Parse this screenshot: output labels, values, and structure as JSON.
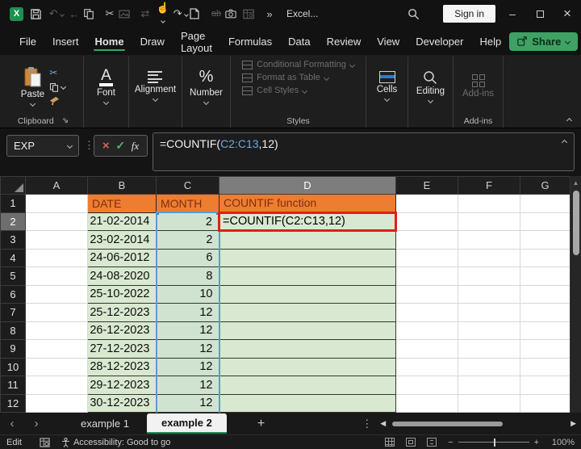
{
  "titlebar": {
    "app_title": "Excel...",
    "signin_label": "Sign in"
  },
  "icons": {
    "undo": "↶",
    "redo": "↷",
    "back": "←",
    "cut": "✂",
    "touch": "☝",
    "replace": "⇄",
    "strike_ab": "ab",
    "overflow": "»",
    "minimize": "–",
    "close": "×",
    "dots": "⋮",
    "prev_sheet": "‹",
    "next_sheet": "›",
    "add_sheet": "+",
    "scroll_left": "◀",
    "scroll_right": "▶",
    "scroll_up": "▲",
    "cancel": "×",
    "enter": "✓",
    "fx": "fx",
    "percent": "%",
    "font_glyph": "A",
    "zoom_minus": "−",
    "zoom_plus": "+",
    "launcher": "⇘"
  },
  "menubar": {
    "tabs": [
      "File",
      "Insert",
      "Home",
      "Draw",
      "Page Layout",
      "Formulas",
      "Data",
      "Review",
      "View",
      "Developer",
      "Help"
    ],
    "active_tab": "Home",
    "share_label": "Share"
  },
  "ribbon": {
    "paste_label": "Paste",
    "font_label": "Font",
    "alignment_label": "Alignment",
    "number_label": "Number",
    "styles_items": [
      "Conditional Formatting",
      "Format as Table",
      "Cell Styles"
    ],
    "cells_label": "Cells",
    "editing_label": "Editing",
    "addins_button_label": "Add-ins",
    "group_labels": {
      "clipboard": "Clipboard",
      "styles": "Styles",
      "addins": "Add-ins"
    }
  },
  "formula_bar": {
    "name_box": "EXP",
    "formula_prefix": "=COUNTIF(",
    "formula_range": "C2:C13",
    "formula_suffix": ",12)"
  },
  "grid": {
    "col_headers": [
      "A",
      "B",
      "C",
      "D",
      "E",
      "F",
      "G"
    ],
    "row_numbers": [
      "1",
      "2",
      "3",
      "4",
      "5",
      "6",
      "7",
      "8",
      "9",
      "10",
      "11",
      "12"
    ],
    "table_headers": {
      "date": "DATE",
      "month": "MONTH",
      "countif": "COUNTIF function"
    },
    "formula_cell_text": "=COUNTIF(C2:C13,12)",
    "rows": [
      {
        "date": "21-02-2014",
        "month": "2"
      },
      {
        "date": "23-02-2014",
        "month": "2"
      },
      {
        "date": "24-06-2012",
        "month": "6"
      },
      {
        "date": "24-08-2020",
        "month": "8"
      },
      {
        "date": "25-10-2022",
        "month": "10"
      },
      {
        "date": "25-12-2023",
        "month": "12"
      },
      {
        "date": "26-12-2023",
        "month": "12"
      },
      {
        "date": "27-12-2023",
        "month": "12"
      },
      {
        "date": "28-12-2023",
        "month": "12"
      },
      {
        "date": "29-12-2023",
        "month": "12"
      },
      {
        "date": "30-12-2023",
        "month": "12"
      }
    ]
  },
  "sheet_tabs": {
    "tab1": "example 1",
    "tab2": "example 2",
    "active": "example 2"
  },
  "status_bar": {
    "mode": "Edit",
    "accessibility": "Accessibility: Good to go",
    "zoom_level": "100%"
  },
  "colors": {
    "accent_green": "#2fa968",
    "header_orange": "#ED7D31",
    "header_text": "#7e2f0e",
    "cell_green": "#d9e9d1",
    "range_blue": "#5b9bd5",
    "annotation_red": "#e01f14",
    "formula_ref_blue": "#6fa8dc"
  }
}
